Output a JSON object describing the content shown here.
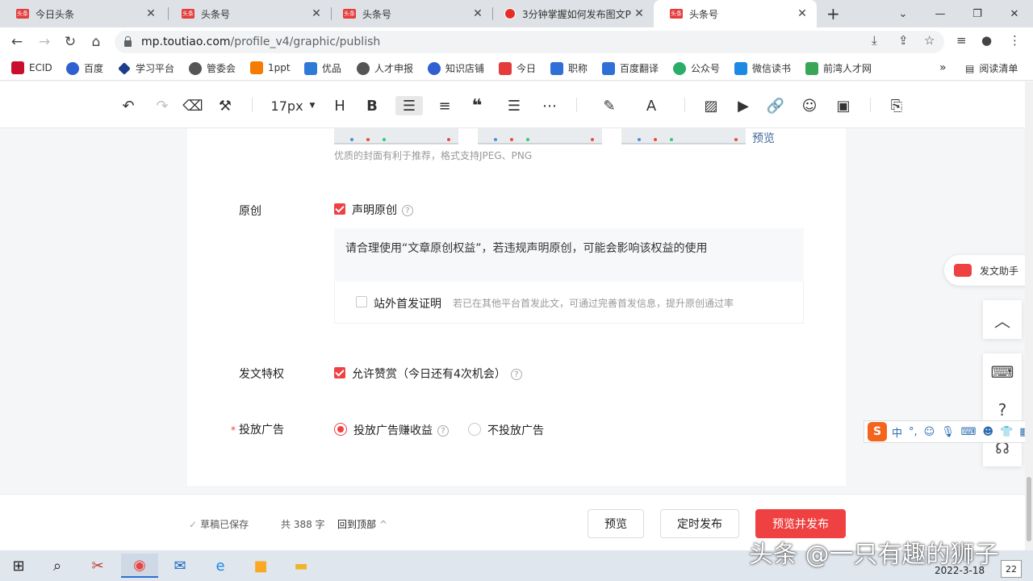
{
  "browser": {
    "tabs": [
      {
        "title": "今日头条",
        "favicon": "toutiao-icon",
        "active": false
      },
      {
        "title": "头条号",
        "favicon": "toutiao-icon",
        "active": false
      },
      {
        "title": "头条号",
        "favicon": "toutiao-icon",
        "active": false
      },
      {
        "title": "3分钟掌握如何发布图文P",
        "favicon": "video-icon",
        "active": false
      },
      {
        "title": "头条号",
        "favicon": "toutiao-icon",
        "active": true
      }
    ],
    "favicon_text": "头条",
    "url_host": "mp.toutiao.com",
    "url_path": "/profile_v4/graphic/publish",
    "bookmarks": [
      "ECID",
      "百度",
      "学习平台",
      "管委会",
      "1ppt",
      "优品",
      "人才申报",
      "知识店铺",
      "今日",
      "职称",
      "百度翻译",
      "公众号",
      "微信读书",
      "前湾人才网"
    ],
    "bookmarks_more": "»",
    "reading_list": "阅读清单"
  },
  "editor_toolbar": {
    "font_size": "17px",
    "heading": "H",
    "bold": "B"
  },
  "form": {
    "preview_link": "预览",
    "cover_hint": "优质的封面有利于推荐，格式支持JPEG、PNG",
    "original": {
      "label": "原创",
      "checkbox_label": "声明原创",
      "checked": true,
      "notice": "请合理使用“文章原创权益”，若违规声明原创，可能会影响该权益的使用",
      "offsite_label": "站外首发证明",
      "offsite_checked": false,
      "offsite_hint": "若已在其他平台首发此文，可通过完善首发信息，提升原创通过率"
    },
    "privilege": {
      "label": "发文特权",
      "checkbox_label": "允许赞赏（今日还有4次机会）",
      "checked": true
    },
    "ads": {
      "required_mark": "*",
      "label": "投放广告",
      "options": [
        "投放广告赚收益",
        "不投放广告"
      ],
      "selected": "投放广告赚收益"
    },
    "help_glyph": "?"
  },
  "footer": {
    "draft_status": "草稿已保存",
    "word_count": "共 388 字",
    "back_to_top": "回到顶部",
    "preview_button": "预览",
    "schedule_button": "定时发布",
    "publish_button": "预览并发布"
  },
  "side": {
    "assistant_label": "发文助手"
  },
  "ime": {
    "logo": "S",
    "mode": "中"
  },
  "taskbar": {
    "clock_date": "2022-3-18",
    "notification_count": "22",
    "watermark": "头条 @一只有趣的狮子"
  },
  "colors": {
    "accent": "#f04142",
    "link": "#406599"
  }
}
